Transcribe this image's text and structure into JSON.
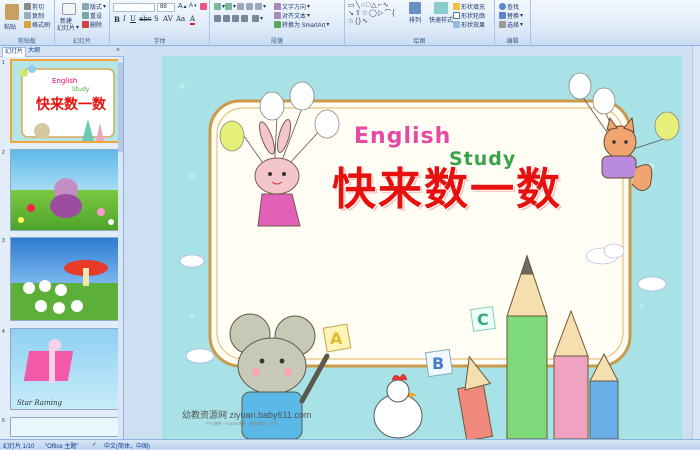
{
  "ribbon": {
    "groups": [
      "剪贴板",
      "幻灯片",
      "字体",
      "段落",
      "绘图",
      "编辑"
    ],
    "clipboard": {
      "paste": "粘贴",
      "cut": "剪切",
      "copy": "复制",
      "format_painter": "格式刷"
    },
    "slides": {
      "new_slide": "新建",
      "new_slide_2": "幻灯片",
      "layout": "版式",
      "reset": "重设",
      "delete": "删除"
    },
    "font": {
      "size": "88"
    },
    "paragraph": {
      "text_direction": "文字方向",
      "align_text": "对齐文本",
      "convert_smartart": "转换为 SmartArt"
    },
    "drawing": {
      "arrange": "排列",
      "quick_styles": "快速样式",
      "shape_fill": "形状填充",
      "shape_outline": "形状轮廓",
      "shape_effects": "形状效果"
    },
    "editing": {
      "find": "查找",
      "replace": "替换",
      "select": "选择"
    }
  },
  "panel": {
    "tabs": [
      "幻灯片",
      "大纲"
    ],
    "slide_numbers": [
      "1",
      "2",
      "3",
      "4",
      "5"
    ],
    "thumb_text": [
      "Star Raining"
    ]
  },
  "slide": {
    "title": "快来数一数",
    "english": "English",
    "study": "Study",
    "letters": [
      "A",
      "B",
      "C"
    ],
    "watermark": "幼教资源网 ziyuan.baby611.com",
    "watermark_sub": "PPT课件 · FLASH课件 · 教案教案 · 试卷"
  },
  "status": {
    "slide_pos": "幻灯片 1/10",
    "theme": "\"Office 主题\"",
    "language": "中文(简体，中国)"
  },
  "colors": {
    "ribbon_border": "#8db2e3",
    "title_red": "#e8100c",
    "slide_bg": "#a9e2e6",
    "selected_thumb": "#f2a637"
  }
}
